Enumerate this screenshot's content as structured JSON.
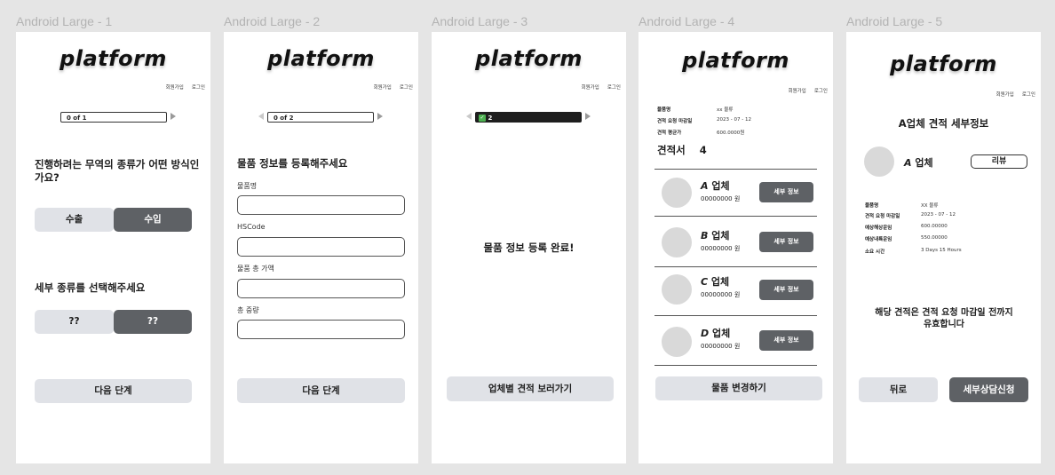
{
  "frames": [
    {
      "label": "Android Large - 1",
      "logo": "platform",
      "pager": "0 of 1",
      "question1": "진행하려는 무역의 종류가 어떤 방식인가요?",
      "option_export": "수출",
      "option_import": "수입",
      "question2": "세부 종류를 선택해주세요",
      "sub_option_1": "??",
      "sub_option_2": "??",
      "next": "다음 단계"
    },
    {
      "label": "Android Large - 2",
      "logo": "platform",
      "signup": "회원가입",
      "login": "로그인",
      "pager": "0 of 2",
      "heading": "물품 정보를 등록해주세요",
      "fields": [
        "물품명",
        "HSCode",
        "물품 총 가액",
        "총 중량"
      ],
      "next": "다음 단계"
    },
    {
      "label": "Android Large - 3",
      "logo": "platform",
      "signup": "회원가입",
      "login": "로그인",
      "pager": "2",
      "message": "물품 정보 등록 완료!",
      "cta": "업체별 견적 보러가기"
    },
    {
      "label": "Android Large - 4",
      "logo": "platform",
      "signup": "회원가입",
      "login": "로그인",
      "info": [
        {
          "key": "물품명",
          "value": "xx 물류"
        },
        {
          "key": "견적 요청 마감일",
          "value": "2023 - 07 - 12"
        },
        {
          "key": "견적 평균가",
          "value": "600.0000원"
        }
      ],
      "quotes_label": "견적서",
      "quotes_count": "4",
      "vendors": [
        {
          "letter": "A",
          "suffix": "업체",
          "price": "00000000 원",
          "button": "세부 정보"
        },
        {
          "letter": "B",
          "suffix": "업체",
          "price": "00000000 원",
          "button": "세부 정보"
        },
        {
          "letter": "C",
          "suffix": "업체",
          "price": "00000000 원",
          "button": "세부 정보"
        },
        {
          "letter": "D",
          "suffix": "업체",
          "price": "00000000 원",
          "button": "세부 정보"
        }
      ],
      "cta": "물품 변경하기"
    },
    {
      "label": "Android Large - 5",
      "logo": "platform",
      "signup": "회원가입",
      "login": "로그인",
      "title": "A업체 견적 세부정보",
      "vendor_letter": "A",
      "vendor_suffix": "업체",
      "review": "리뷰",
      "info": [
        {
          "key": "물품명",
          "value": "XX 물류"
        },
        {
          "key": "견적 요청 마감일",
          "value": "2023 - 07 - 12"
        },
        {
          "key": "예상해상운임",
          "value": "600.00000"
        },
        {
          "key": "예상내륙운임",
          "value": "550.00000"
        },
        {
          "key": "소요 시간",
          "value": "3 Days 15 Hours"
        }
      ],
      "notice": "해당 견적은 견적 요청 마감일 전까지 유효합니다",
      "back": "뒤로",
      "consult": "세부상담신청"
    }
  ],
  "colors": {
    "background": "#e5e5e5",
    "button_light": "#e0e2e7",
    "button_dark": "#5e6165",
    "progress_check": "#4caf50"
  }
}
